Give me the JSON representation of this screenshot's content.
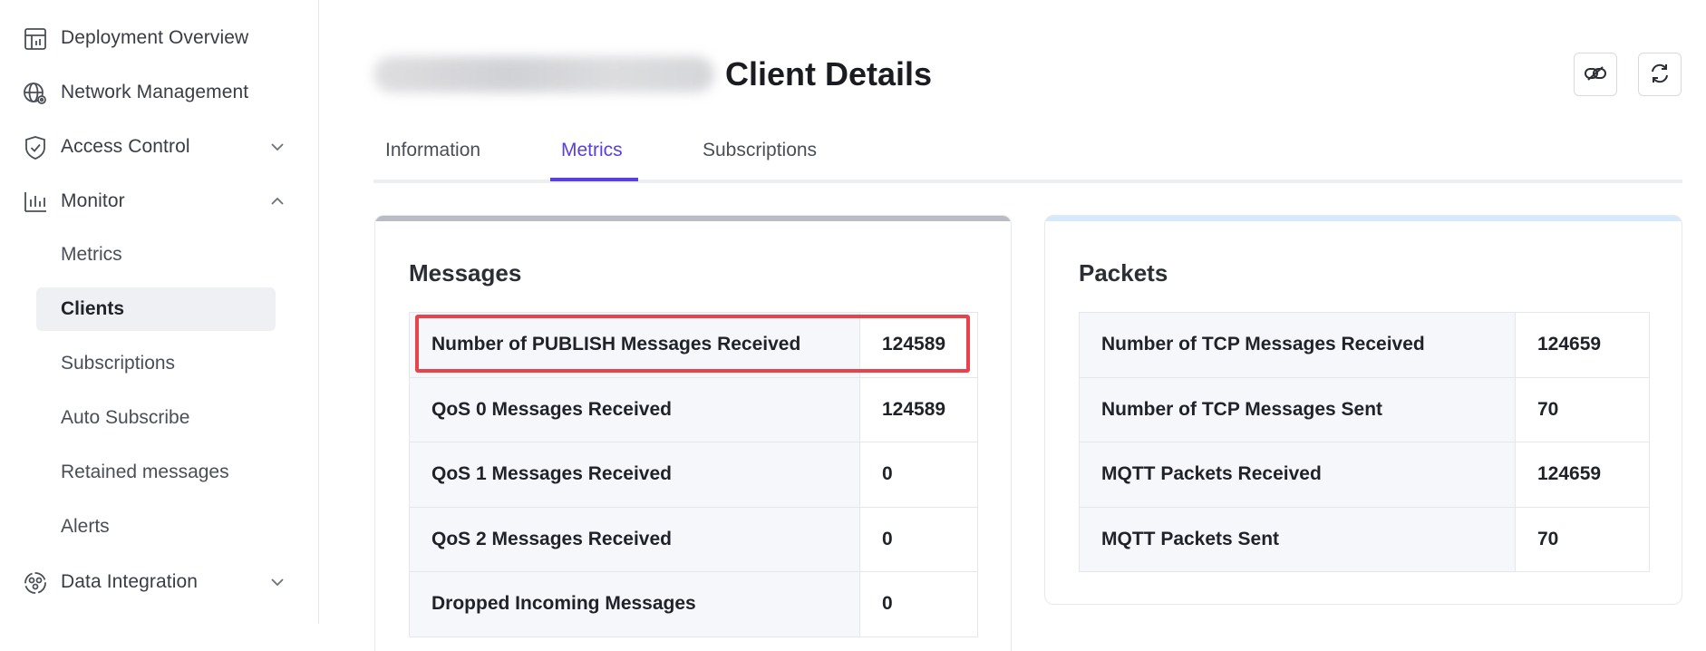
{
  "sidebar": {
    "items": [
      {
        "label": "Deployment Overview",
        "icon": "deployment-overview-icon"
      },
      {
        "label": "Network Management",
        "icon": "network-management-icon"
      },
      {
        "label": "Access Control",
        "icon": "shield-icon",
        "expanded": false
      },
      {
        "label": "Monitor",
        "icon": "monitor-chart-icon",
        "expanded": true
      },
      {
        "label": "Data Integration",
        "icon": "data-integration-icon",
        "expanded": false
      }
    ],
    "monitor_children": [
      {
        "label": "Metrics"
      },
      {
        "label": "Clients",
        "active": true
      },
      {
        "label": "Subscriptions"
      },
      {
        "label": "Auto Subscribe"
      },
      {
        "label": "Retained messages"
      },
      {
        "label": "Alerts"
      }
    ]
  },
  "header": {
    "title": "Client Details",
    "buttons": [
      {
        "icon": "disconnect-link-icon"
      },
      {
        "icon": "refresh-icon"
      }
    ]
  },
  "tabs": [
    {
      "label": "Information"
    },
    {
      "label": "Metrics",
      "active": true
    },
    {
      "label": "Subscriptions"
    }
  ],
  "messages_card": {
    "title": "Messages",
    "rows": [
      {
        "name": "Number of PUBLISH Messages Received",
        "value": "124589"
      },
      {
        "name": "QoS 0 Messages Received",
        "value": "124589"
      },
      {
        "name": "QoS 1 Messages Received",
        "value": "0"
      },
      {
        "name": "QoS 2 Messages Received",
        "value": "0"
      },
      {
        "name": "Dropped Incoming Messages",
        "value": "0"
      }
    ]
  },
  "packets_card": {
    "title": "Packets",
    "rows": [
      {
        "name": "Number of TCP Messages Received",
        "value": "124659"
      },
      {
        "name": "Number of TCP Messages Sent",
        "value": "70"
      },
      {
        "name": "MQTT Packets Received",
        "value": "124659"
      },
      {
        "name": "MQTT Packets Sent",
        "value": "70"
      }
    ]
  },
  "colors": {
    "accent": "#5a3ee0",
    "highlight": "#e8424a",
    "messages_card_top": "#b9bcc5",
    "packets_card_top": "#d6e8fb"
  }
}
